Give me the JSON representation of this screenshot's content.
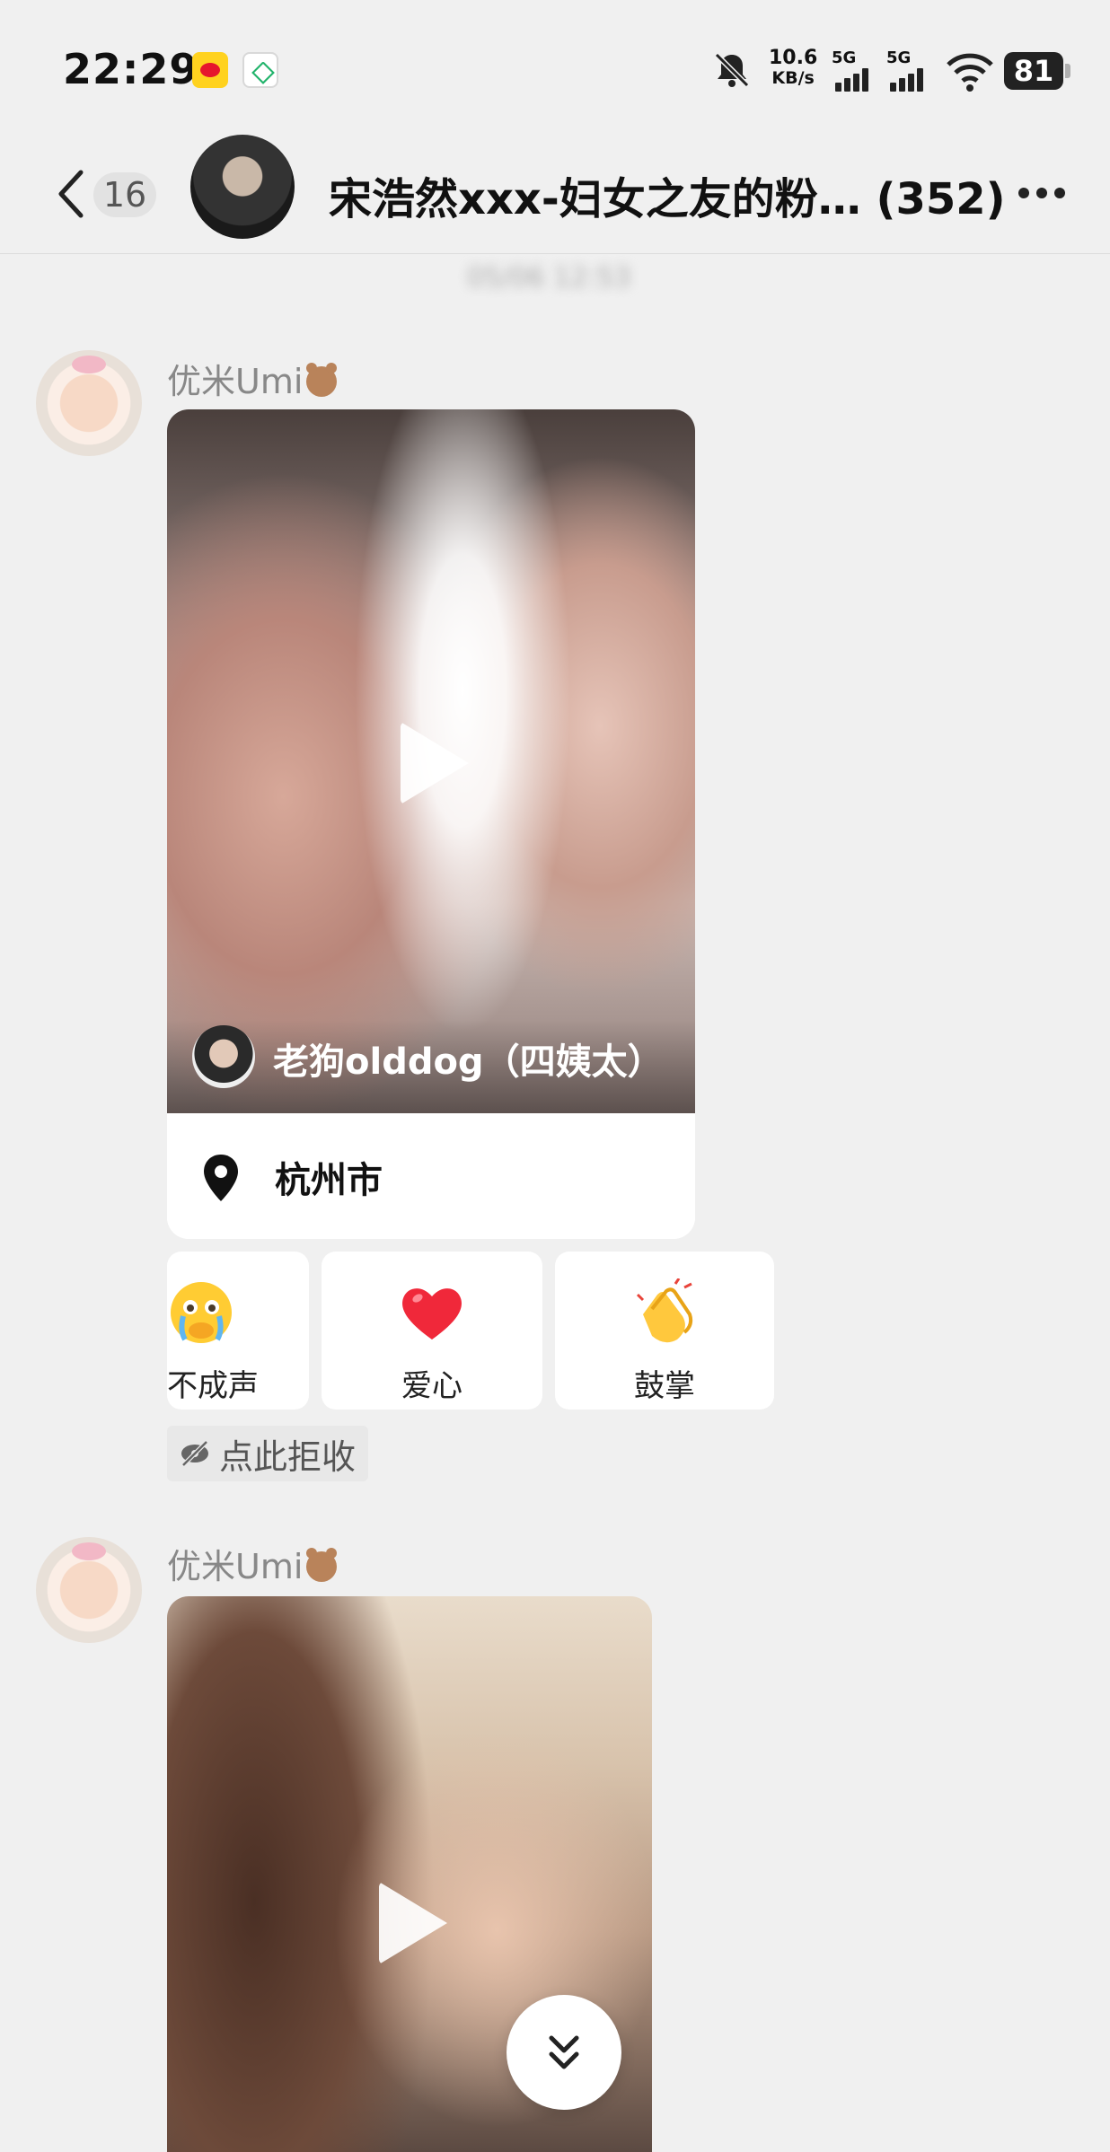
{
  "status_bar": {
    "time": "22:29",
    "net_speed_value": "10.6",
    "net_speed_unit": "KB/s",
    "signal_1_label": "5G",
    "signal_2_label": "5G",
    "battery": "81"
  },
  "header": {
    "unread_count": "16",
    "title": "宋浩然xxx-妇女之友的粉… (352)"
  },
  "timestamp": "05/06 12:53",
  "messages": [
    {
      "sender": "优米Umi",
      "video": {
        "author": "老狗olddog（四姨太）",
        "location": "杭州市"
      },
      "reactions": [
        {
          "icon": "crying-face-icon",
          "label": "不成声"
        },
        {
          "icon": "red-heart-icon",
          "label": "爱心"
        },
        {
          "icon": "clapping-hands-icon",
          "label": "鼓掌"
        }
      ],
      "reject_label": "点此拒收"
    },
    {
      "sender": "优米Umi"
    }
  ]
}
